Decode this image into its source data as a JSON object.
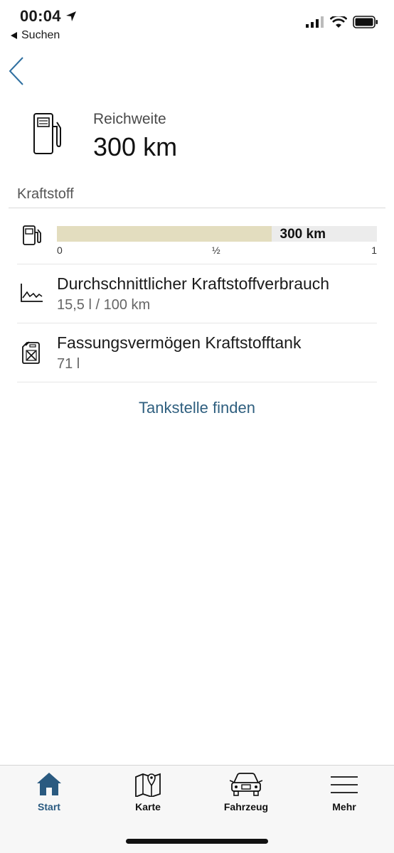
{
  "status_bar": {
    "time": "00:04",
    "back_app": "Suchen"
  },
  "header": {
    "range_label": "Reichweite",
    "range_value": "300 km"
  },
  "fuel_section": {
    "title": "Kraftstoff",
    "gauge": {
      "level_fraction": 0.67,
      "value_label": "300 km",
      "ticks": [
        "0",
        "½",
        "1"
      ]
    },
    "rows": [
      {
        "icon": "chart-line-icon",
        "label": "Durchschnittlicher Kraftstoffverbrauch",
        "value": "15,5 l / 100 km"
      },
      {
        "icon": "jerrycan-icon",
        "label": "Fassungsvermögen Kraftstofftank",
        "value": "71 l"
      }
    ],
    "find_station": "Tankstelle finden"
  },
  "tab_bar": {
    "tabs": [
      {
        "label": "Start",
        "icon": "home-icon",
        "active": true
      },
      {
        "label": "Karte",
        "icon": "map-icon",
        "active": false
      },
      {
        "label": "Fahrzeug",
        "icon": "car-icon",
        "active": false
      },
      {
        "label": "Mehr",
        "icon": "menu-icon",
        "active": false
      }
    ]
  },
  "colors": {
    "accent": "#2f5f7f",
    "gauge_fill": "#e3ddbf",
    "gauge_track": "#ececec",
    "active_tab": "#2a5a80"
  }
}
